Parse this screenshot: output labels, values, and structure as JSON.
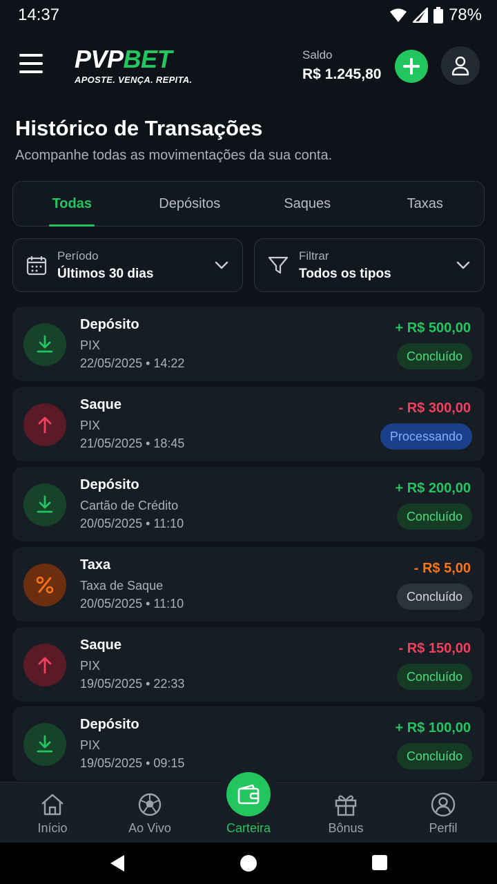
{
  "status_bar": {
    "time": "14:37",
    "battery": "78%"
  },
  "header": {
    "logo_pvp": "PVP",
    "logo_bet": "BET",
    "logo_tagline": "APOSTE. VENÇA. REPITA.",
    "balance_label": "Saldo",
    "balance_value": "R$ 1.245,80"
  },
  "page": {
    "title": "Histórico de Transações",
    "subtitle": "Acompanhe todas as movimentações da sua conta."
  },
  "tabs": [
    {
      "label": "Todas",
      "active": true
    },
    {
      "label": "Depósitos",
      "active": false
    },
    {
      "label": "Saques",
      "active": false
    },
    {
      "label": "Taxas",
      "active": false
    }
  ],
  "filters": {
    "period": {
      "label": "Período",
      "value": "Últimos 30 dias"
    },
    "type": {
      "label": "Filtrar",
      "value": "Todos os tipos"
    }
  },
  "transactions": [
    {
      "title": "Depósito",
      "method": "PIX",
      "date": "22/05/2025 • 14:22",
      "amount": "+ R$ 500,00",
      "status": "Concluído",
      "kind": "deposit",
      "status_kind": "ok"
    },
    {
      "title": "Saque",
      "method": "PIX",
      "date": "21/05/2025 • 18:45",
      "amount": "- R$ 300,00",
      "status": "Processando",
      "kind": "withdraw",
      "status_kind": "processing"
    },
    {
      "title": "Depósito",
      "method": "Cartão de Crédito",
      "date": "20/05/2025 • 11:10",
      "amount": "+ R$ 200,00",
      "status": "Concluído",
      "kind": "deposit",
      "status_kind": "ok"
    },
    {
      "title": "Taxa",
      "method": "Taxa de Saque",
      "date": "20/05/2025 • 11:10",
      "amount": "- R$ 5,00",
      "status": "Concluído",
      "kind": "fee",
      "status_kind": "neutral"
    },
    {
      "title": "Saque",
      "method": "PIX",
      "date": "19/05/2025 • 22:33",
      "amount": "- R$ 150,00",
      "status": "Concluído",
      "kind": "withdraw",
      "status_kind": "ok"
    },
    {
      "title": "Depósito",
      "method": "PIX",
      "date": "19/05/2025 • 09:15",
      "amount": "+ R$ 100,00",
      "status": "Concluído",
      "kind": "deposit",
      "status_kind": "ok"
    }
  ],
  "bottom_nav": [
    {
      "label": "Início",
      "icon": "home-icon"
    },
    {
      "label": "Ao Vivo",
      "icon": "soccer-ball-icon"
    },
    {
      "label": "Carteira",
      "icon": "wallet-icon",
      "active": true
    },
    {
      "label": "Bônus",
      "icon": "gift-icon"
    },
    {
      "label": "Perfil",
      "icon": "user-icon"
    }
  ],
  "colors": {
    "accent": "#22c55e",
    "negative": "#f43f5e",
    "fee": "#f97316",
    "background": "#0e131a"
  }
}
